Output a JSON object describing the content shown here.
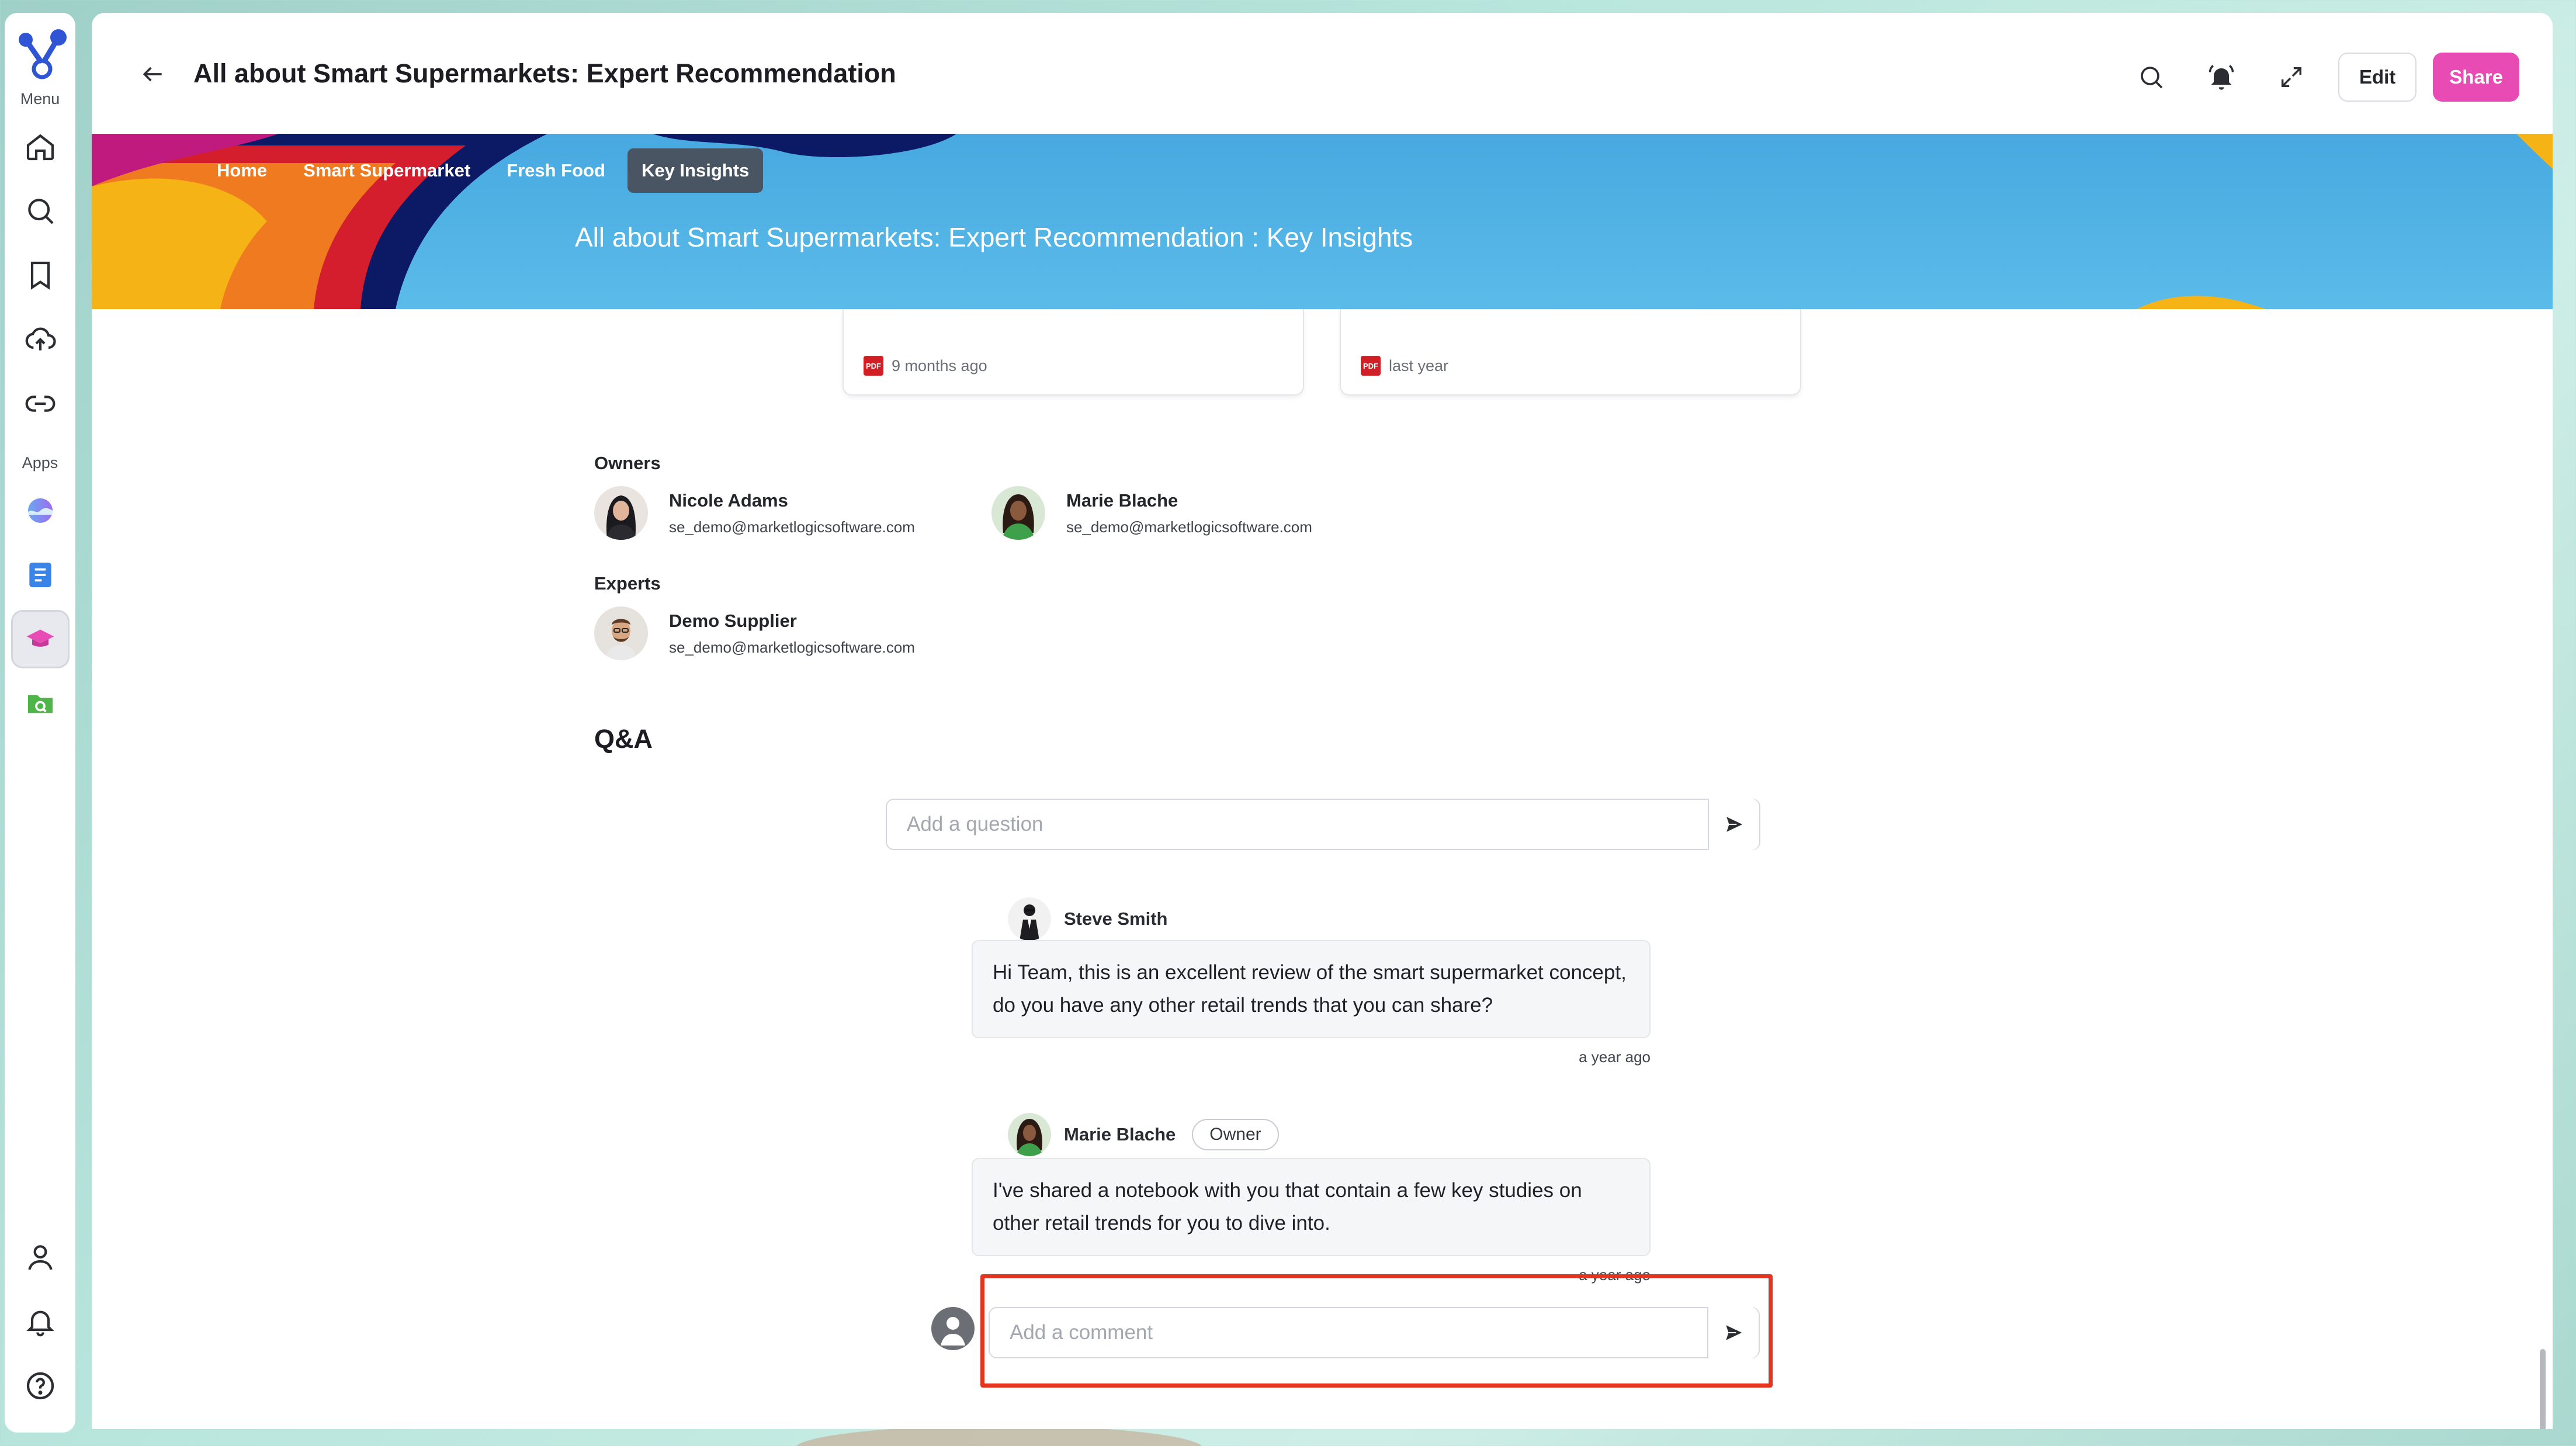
{
  "rail": {
    "menu_label": "Menu",
    "apps_label": "Apps",
    "menu_items": [
      "home-icon",
      "search-icon",
      "bookmark-icon",
      "upload-cloud-icon",
      "link-icon"
    ],
    "app_items": [
      "wave-app-icon",
      "document-app-icon",
      "graduation-app-icon",
      "folder-search-app-icon"
    ],
    "bottom_items": [
      "user-icon",
      "bell-icon",
      "help-icon"
    ]
  },
  "header": {
    "title": "All about Smart Supermarkets: Expert Recommendation",
    "edit_label": "Edit",
    "share_label": "Share",
    "share_color": "#e84bb3"
  },
  "banner": {
    "tabs": [
      "Home",
      "Smart Supermarket",
      "Fresh Food",
      "Key Insights"
    ],
    "active_tab": "Key Insights",
    "title": "All about Smart Supermarkets: Expert Recommendation  :  Key Insights"
  },
  "documents": [
    {
      "type": "PDF",
      "time": "9 months ago"
    },
    {
      "type": "PDF",
      "time": "last year"
    }
  ],
  "owners": {
    "heading": "Owners",
    "people": [
      {
        "name": "Nicole Adams",
        "email": "se_demo@marketlogicsoftware.com"
      },
      {
        "name": "Marie Blache",
        "email": "se_demo@marketlogicsoftware.com"
      }
    ]
  },
  "experts": {
    "heading": "Experts",
    "people": [
      {
        "name": "Demo Supplier",
        "email": "se_demo@marketlogicsoftware.com"
      }
    ]
  },
  "qa": {
    "title": "Q&A",
    "question_placeholder": "Add a question",
    "comments": [
      {
        "author": "Steve Smith",
        "text": "Hi Team, this is an excellent review of the smart supermarket concept, do you have any other retail trends that you can share?",
        "time": "a year ago"
      },
      {
        "author": "Marie Blache",
        "badge": "Owner",
        "text": "I've shared a notebook with you that contain a few key studies on other retail trends for you to dive into.",
        "time": "a year ago"
      }
    ],
    "comment_placeholder": "Add a comment"
  }
}
